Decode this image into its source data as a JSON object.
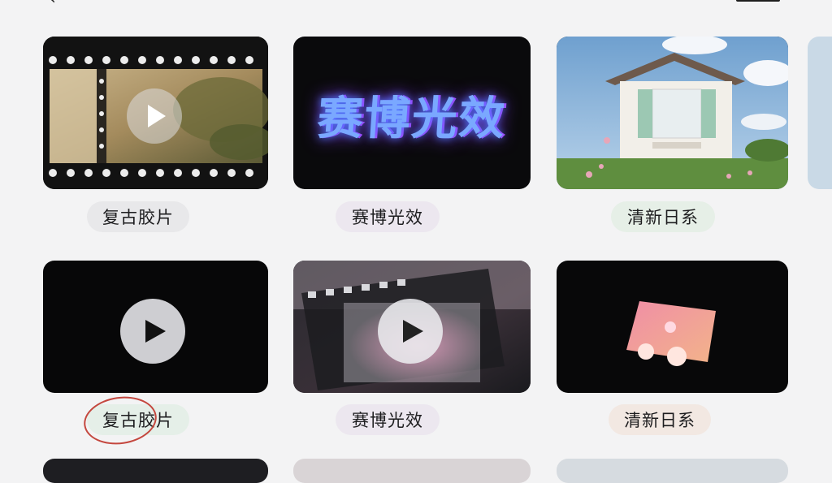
{
  "header": {
    "back_glyph": "‹"
  },
  "grid": {
    "row1": [
      {
        "label": "复古胶片",
        "thumb": "film-strip-garden-video"
      },
      {
        "label": "赛博光效",
        "thumb": "cyber-neon-text",
        "overlay_text": "赛博光效"
      },
      {
        "label": "清新日系",
        "thumb": "cottage-house-photo"
      }
    ],
    "row2": [
      {
        "label": "复古胶片",
        "thumb": "black-video-placeholder"
      },
      {
        "label": "赛博光效",
        "thumb": "film-frame-glass-video"
      },
      {
        "label": "清新日系",
        "thumb": "pink-photo-card"
      }
    ]
  },
  "colors": {
    "background": "#f3f3f4",
    "tile_dark": "#0b0b0d",
    "annotation_red": "#c4473e"
  }
}
